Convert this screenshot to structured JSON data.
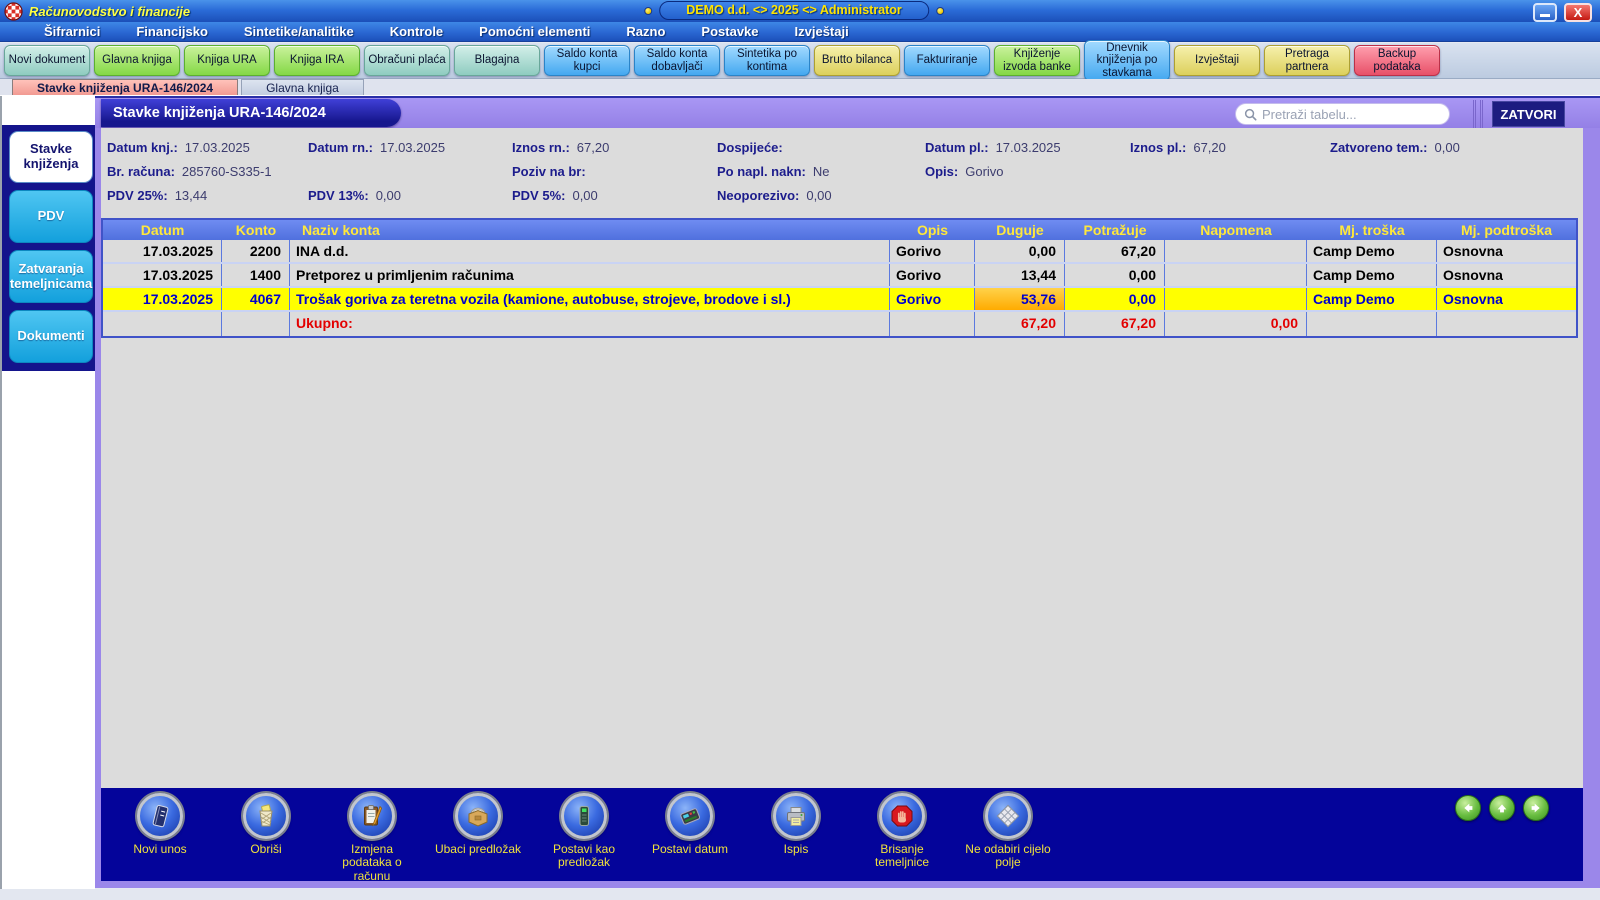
{
  "window": {
    "app_title": "Računovodstvo i financije",
    "session_badge": "DEMO d.d. <> 2025 <> Administrator",
    "close_glyph": "X"
  },
  "menu": {
    "items": [
      "Šifrarnici",
      "Financijsko",
      "Sintetike/analitike",
      "Kontrole",
      "Pomoćni elementi",
      "Razno",
      "Postavke",
      "Izvještaji"
    ]
  },
  "toolbar": {
    "buttons": [
      {
        "label": "Novi dokument",
        "color": "teal"
      },
      {
        "label": "Glavna knjiga",
        "color": "green"
      },
      {
        "label": "Knjiga URA",
        "color": "green"
      },
      {
        "label": "Knjiga IRA",
        "color": "green"
      },
      {
        "label": "Obračuni plaća",
        "color": "teal"
      },
      {
        "label": "Blagajna",
        "color": "teal"
      },
      {
        "label": "Saldo konta kupci",
        "color": "blue"
      },
      {
        "label": "Saldo konta dobavljači",
        "color": "blue"
      },
      {
        "label": "Sintetika po kontima",
        "color": "blue"
      },
      {
        "label": "Brutto bilanca",
        "color": "yellow"
      },
      {
        "label": "Fakturiranje",
        "color": "blue"
      },
      {
        "label": "Knjiženje izvoda banke",
        "color": "green"
      },
      {
        "label": "Dnevnik knjiženja po stavkama",
        "color": "blue"
      },
      {
        "label": "Izvještaji",
        "color": "yellow"
      },
      {
        "label": "Pretraga partnera",
        "color": "yellow"
      },
      {
        "label": "Backup podataka",
        "color": "red"
      }
    ]
  },
  "doc_tabs": {
    "items": [
      {
        "label": "Stavke knjiženja  URA-146/2024",
        "active": true
      },
      {
        "label": "Glavna knjiga",
        "active": false
      }
    ]
  },
  "sidebar": {
    "tabs": [
      {
        "label": "Stavke knjiženja",
        "active": true
      },
      {
        "label": "PDV",
        "active": false
      },
      {
        "label": "Zatvaranja temeljnicama",
        "active": false
      },
      {
        "label": "Dokumenti",
        "active": false
      }
    ]
  },
  "panel": {
    "title": "Stavke knjiženja URA-146/2024",
    "search_placeholder": "Pretraži tabelu...",
    "close_button": "ZATVORI"
  },
  "details": {
    "fields": [
      {
        "label": "Datum knj.:",
        "value": "17.03.2025"
      },
      {
        "label": "Datum rn.:",
        "value": "17.03.2025"
      },
      {
        "label": "Iznos rn.:",
        "value": "67,20"
      },
      {
        "label": "Dospijeće:",
        "value": ""
      },
      {
        "label": "Datum pl.:",
        "value": "17.03.2025"
      },
      {
        "label": "Iznos pl.:",
        "value": "67,20"
      },
      {
        "label": "Zatvoreno tem.:",
        "value": "0,00"
      },
      {
        "label": "Br. računa:",
        "value": "285760-S335-1"
      },
      {
        "label": "Poziv na br:",
        "value": ""
      },
      {
        "label": "Po napl. nakn:",
        "value": "Ne"
      },
      {
        "label": "Opis:",
        "value": "Gorivo"
      },
      {
        "label": "PDV 25%:",
        "value": "13,44"
      },
      {
        "label": "PDV 13%:",
        "value": "0,00"
      },
      {
        "label": "PDV 5%:",
        "value": "0,00"
      },
      {
        "label": "Neoporezivo:",
        "value": "0,00"
      }
    ]
  },
  "table": {
    "columns": [
      "Datum",
      "Konto",
      "Naziv konta",
      "Opis",
      "Duguje",
      "Potražuje",
      "Napomena",
      "Mj. troška",
      "Mj. podtroška"
    ],
    "rows": [
      {
        "datum": "17.03.2025",
        "konto": "2200",
        "naziv": "INA d.d.",
        "opis": "Gorivo",
        "duguje": "0,00",
        "potrazuje": "67,20",
        "napomena": "",
        "mj_troska": "Camp Demo",
        "mj_podtroska": "Osnovna"
      },
      {
        "datum": "17.03.2025",
        "konto": "1400",
        "naziv": "Pretporez u primljenim računima",
        "opis": "Gorivo",
        "duguje": "13,44",
        "potrazuje": "0,00",
        "napomena": "",
        "mj_troska": "Camp Demo",
        "mj_podtroska": "Osnovna"
      },
      {
        "datum": "17.03.2025",
        "konto": "4067",
        "naziv": "Trošak goriva za teretna vozila (kamione, autobuse, strojeve, brodove i sl.)",
        "opis": "Gorivo",
        "duguje": "53,76",
        "potrazuje": "0,00",
        "napomena": "",
        "mj_troska": "Camp Demo",
        "mj_podtroska": "Osnovna"
      }
    ],
    "total": {
      "label": "Ukupno:",
      "duguje": "67,20",
      "potrazuje": "67,20",
      "napomena": "0,00"
    }
  },
  "actions": {
    "buttons": [
      {
        "label": "Novi unos",
        "icon": "notebook-icon"
      },
      {
        "label": "Obriši",
        "icon": "trash-icon"
      },
      {
        "label": "Izmjena podataka o računu",
        "icon": "clipboard-pencil-icon"
      },
      {
        "label": "Ubaci predložak",
        "icon": "card-box-icon"
      },
      {
        "label": "Postavi kao predložak",
        "icon": "device-icon"
      },
      {
        "label": "Postavi datum",
        "icon": "calculator-icon"
      },
      {
        "label": "Ispis",
        "icon": "printer-icon"
      },
      {
        "label": "Brisanje temeljnice",
        "icon": "stop-hand-icon"
      },
      {
        "label": "Ne odabiri cijelo polje",
        "icon": "keyboard-icon"
      }
    ],
    "nav": [
      "left",
      "up",
      "right"
    ]
  },
  "palette": {
    "titlebar_blue": "#2b6cd8",
    "panel_purple": "#9b87ea",
    "table_header_blue": "#5b79e0",
    "header_text_yellow": "#ffe83a",
    "selected_row_yellow": "#ffff00",
    "selected_text_blue": "#0000cd",
    "active_cell_orange": "#ffbe30",
    "total_red": "#e30000",
    "bottom_bar_navy": "#04049a",
    "sidebar_cyan": "#13a0dc",
    "active_tab_salmon": "#f29a92",
    "toolbar_teal": "#8fccc0",
    "toolbar_green": "#84d846",
    "toolbar_blue": "#44a8f0",
    "toolbar_yellow": "#dcd05c",
    "toolbar_red": "#e85068"
  }
}
